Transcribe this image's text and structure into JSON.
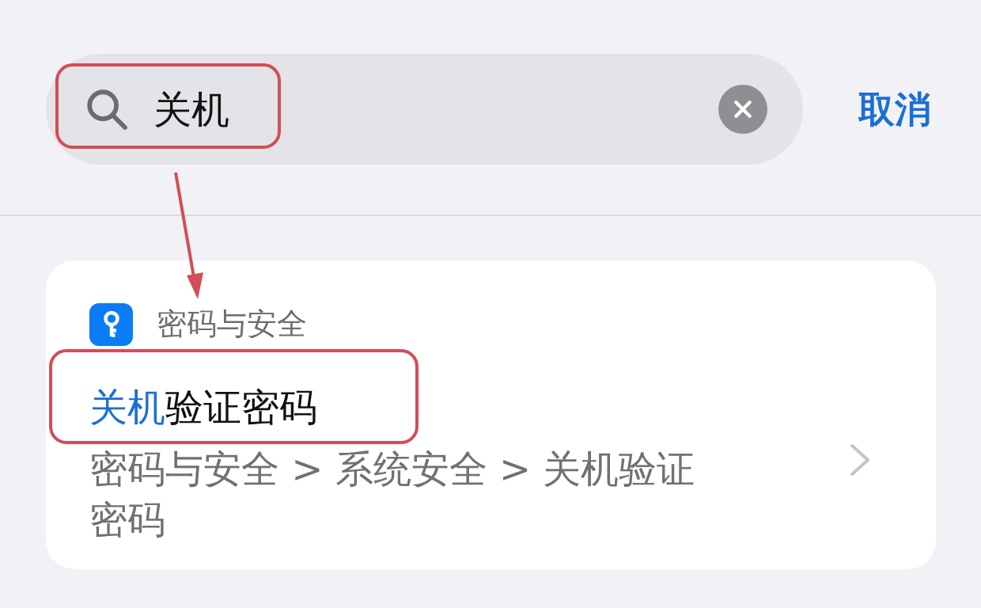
{
  "search": {
    "value": "关机",
    "cancel": "取消"
  },
  "result": {
    "category": "密码与安全",
    "title": [
      {
        "text": "关机",
        "matched": true
      },
      {
        "text": "验证密码",
        "matched": false
      }
    ],
    "path": "密码与安全 > 系统安全 > 关机验证密码"
  }
}
